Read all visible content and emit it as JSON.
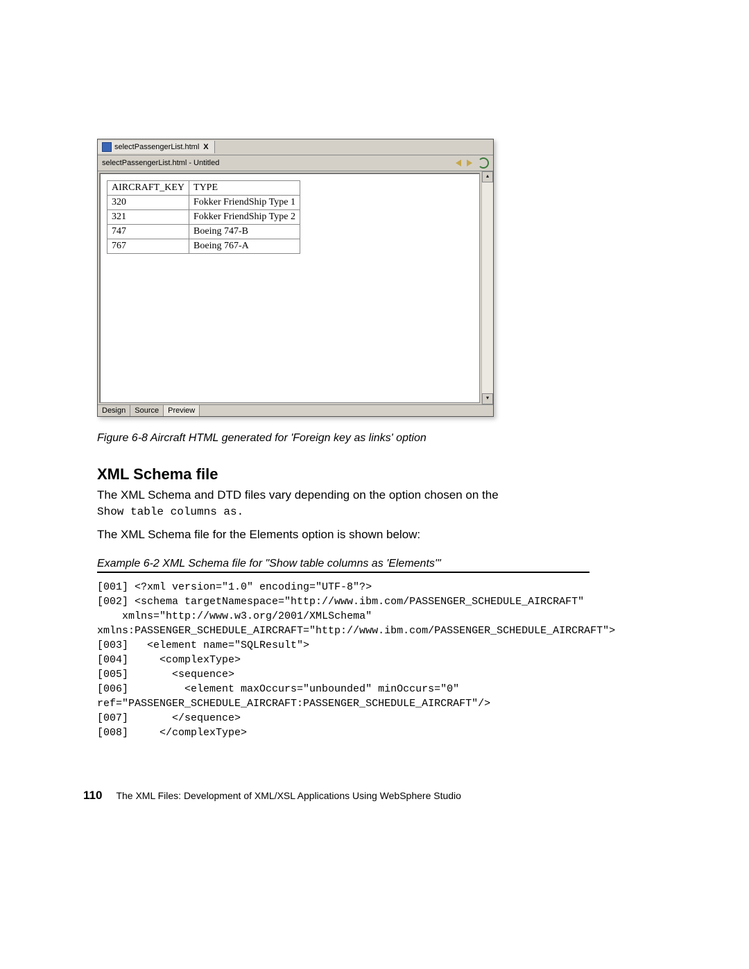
{
  "screenshot": {
    "tab_label": "selectPassengerList.html",
    "tab_close": "X",
    "title": "selectPassengerList.html - Untitled",
    "table": {
      "headers": [
        "AIRCRAFT_KEY",
        "TYPE"
      ],
      "rows": [
        [
          "320",
          "Fokker FriendShip Type 1"
        ],
        [
          "321",
          "Fokker FriendShip Type 2"
        ],
        [
          "747",
          "Boeing 747-B"
        ],
        [
          "767",
          "Boeing 767-A"
        ]
      ]
    },
    "bottom_tabs": [
      "Design",
      "Source",
      "Preview"
    ],
    "active_bottom_tab": 2
  },
  "figure_caption": "Figure 6-8   Aircraft HTML generated for 'Foreign key as links' option",
  "section_title": "XML Schema file",
  "para1_a": "The XML Schema and DTD files vary depending on the option chosen on the ",
  "para1_b": "Show table columns as.",
  "para2": "The XML Schema file for the Elements option is shown below:",
  "example_caption": "Example 6-2   XML Schema file for \"Show table columns as 'Elements'\"",
  "code": "[001] <?xml version=\"1.0\" encoding=\"UTF-8\"?>\n[002] <schema targetNamespace=\"http://www.ibm.com/PASSENGER_SCHEDULE_AIRCRAFT\"\n    xmlns=\"http://www.w3.org/2001/XMLSchema\"\nxmlns:PASSENGER_SCHEDULE_AIRCRAFT=\"http://www.ibm.com/PASSENGER_SCHEDULE_AIRCRAFT\">\n[003]   <element name=\"SQLResult\">\n[004]     <complexType>\n[005]       <sequence>\n[006]         <element maxOccurs=\"unbounded\" minOccurs=\"0\"\nref=\"PASSENGER_SCHEDULE_AIRCRAFT:PASSENGER_SCHEDULE_AIRCRAFT\"/>\n[007]       </sequence>\n[008]     </complexType>",
  "footer": {
    "page_number": "110",
    "book_title": "The XML Files:  Development of XML/XSL Applications Using WebSphere Studio"
  }
}
